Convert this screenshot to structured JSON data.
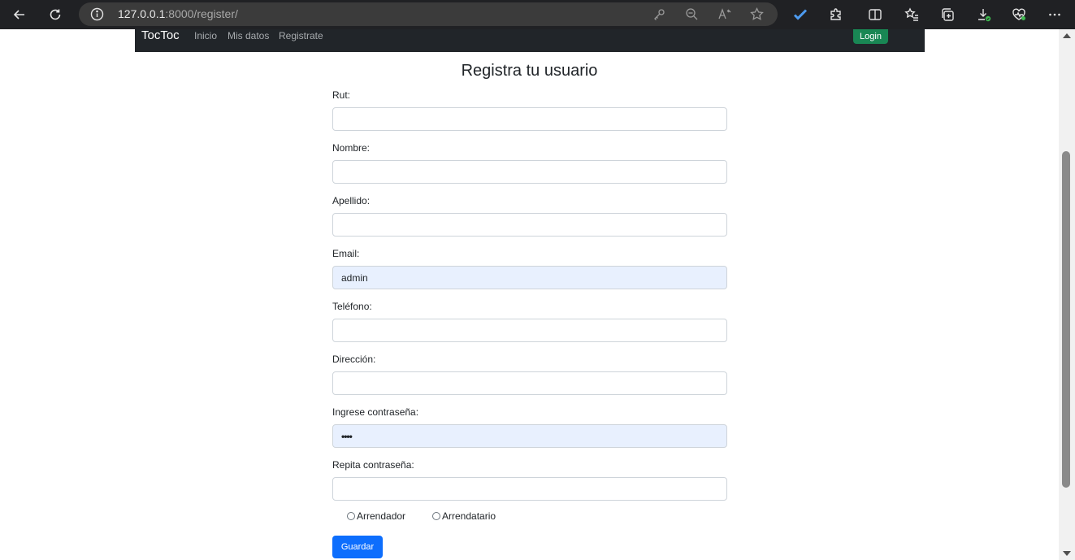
{
  "browser": {
    "url_host": "127.0.0.1",
    "url_path": ":8000/register/"
  },
  "navbar": {
    "brand": "TocToc",
    "links": [
      "Inicio",
      "Mis datos",
      "Registrate"
    ],
    "login_label": "Login"
  },
  "page": {
    "title": "Registra tu usuario"
  },
  "form": {
    "fields": [
      {
        "label": "Rut:",
        "value": "",
        "autofill": false
      },
      {
        "label": "Nombre:",
        "value": "",
        "autofill": false
      },
      {
        "label": "Apellido:",
        "value": "",
        "autofill": false
      },
      {
        "label": "Email:",
        "value": "admin",
        "autofill": true
      },
      {
        "label": "Teléfono:",
        "value": "",
        "autofill": false
      },
      {
        "label": "Dirección:",
        "value": "",
        "autofill": false
      },
      {
        "label": "Ingrese contraseña:",
        "value": "••••",
        "autofill": true
      },
      {
        "label": "Repita contraseña:",
        "value": "",
        "autofill": false
      }
    ],
    "radio_options": [
      "Arrendador",
      "Arrendatario"
    ],
    "submit_label": "Guardar"
  },
  "colors": {
    "navbar_bg": "#212529",
    "login_bg": "#198754",
    "submit_bg": "#0d6efd",
    "autofill_bg": "#e8f0fe"
  }
}
